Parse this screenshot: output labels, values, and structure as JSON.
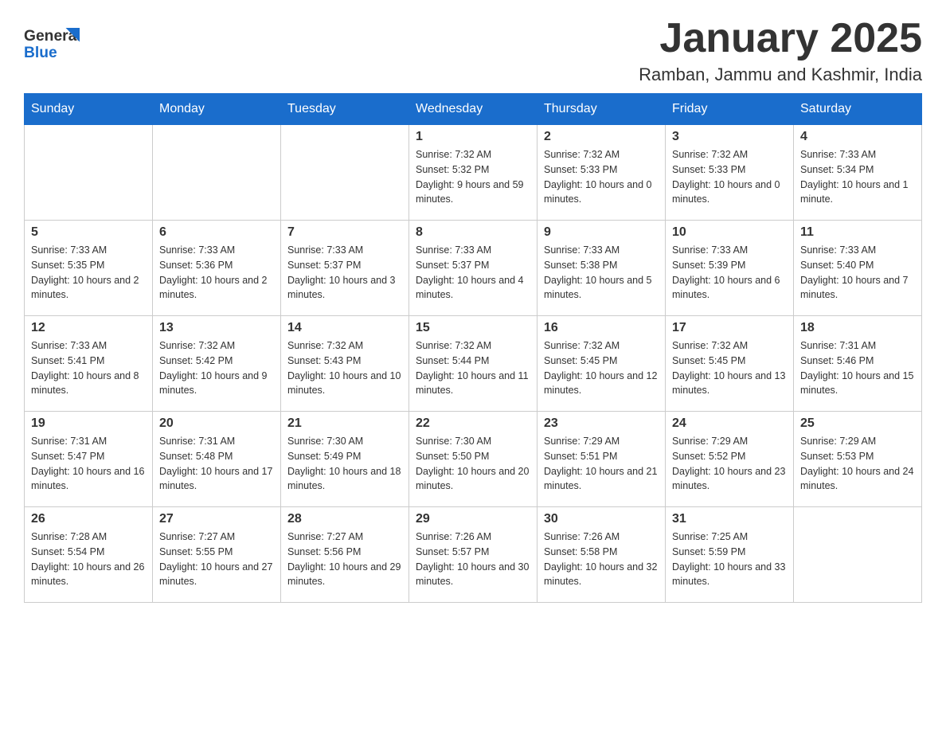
{
  "header": {
    "title": "January 2025",
    "location": "Ramban, Jammu and Kashmir, India",
    "logo_general": "General",
    "logo_blue": "Blue"
  },
  "days_of_week": [
    "Sunday",
    "Monday",
    "Tuesday",
    "Wednesday",
    "Thursday",
    "Friday",
    "Saturday"
  ],
  "weeks": [
    [
      {
        "day": "",
        "sunrise": "",
        "sunset": "",
        "daylight": ""
      },
      {
        "day": "",
        "sunrise": "",
        "sunset": "",
        "daylight": ""
      },
      {
        "day": "",
        "sunrise": "",
        "sunset": "",
        "daylight": ""
      },
      {
        "day": "1",
        "sunrise": "Sunrise: 7:32 AM",
        "sunset": "Sunset: 5:32 PM",
        "daylight": "Daylight: 9 hours and 59 minutes."
      },
      {
        "day": "2",
        "sunrise": "Sunrise: 7:32 AM",
        "sunset": "Sunset: 5:33 PM",
        "daylight": "Daylight: 10 hours and 0 minutes."
      },
      {
        "day": "3",
        "sunrise": "Sunrise: 7:32 AM",
        "sunset": "Sunset: 5:33 PM",
        "daylight": "Daylight: 10 hours and 0 minutes."
      },
      {
        "day": "4",
        "sunrise": "Sunrise: 7:33 AM",
        "sunset": "Sunset: 5:34 PM",
        "daylight": "Daylight: 10 hours and 1 minute."
      }
    ],
    [
      {
        "day": "5",
        "sunrise": "Sunrise: 7:33 AM",
        "sunset": "Sunset: 5:35 PM",
        "daylight": "Daylight: 10 hours and 2 minutes."
      },
      {
        "day": "6",
        "sunrise": "Sunrise: 7:33 AM",
        "sunset": "Sunset: 5:36 PM",
        "daylight": "Daylight: 10 hours and 2 minutes."
      },
      {
        "day": "7",
        "sunrise": "Sunrise: 7:33 AM",
        "sunset": "Sunset: 5:37 PM",
        "daylight": "Daylight: 10 hours and 3 minutes."
      },
      {
        "day": "8",
        "sunrise": "Sunrise: 7:33 AM",
        "sunset": "Sunset: 5:37 PM",
        "daylight": "Daylight: 10 hours and 4 minutes."
      },
      {
        "day": "9",
        "sunrise": "Sunrise: 7:33 AM",
        "sunset": "Sunset: 5:38 PM",
        "daylight": "Daylight: 10 hours and 5 minutes."
      },
      {
        "day": "10",
        "sunrise": "Sunrise: 7:33 AM",
        "sunset": "Sunset: 5:39 PM",
        "daylight": "Daylight: 10 hours and 6 minutes."
      },
      {
        "day": "11",
        "sunrise": "Sunrise: 7:33 AM",
        "sunset": "Sunset: 5:40 PM",
        "daylight": "Daylight: 10 hours and 7 minutes."
      }
    ],
    [
      {
        "day": "12",
        "sunrise": "Sunrise: 7:33 AM",
        "sunset": "Sunset: 5:41 PM",
        "daylight": "Daylight: 10 hours and 8 minutes."
      },
      {
        "day": "13",
        "sunrise": "Sunrise: 7:32 AM",
        "sunset": "Sunset: 5:42 PM",
        "daylight": "Daylight: 10 hours and 9 minutes."
      },
      {
        "day": "14",
        "sunrise": "Sunrise: 7:32 AM",
        "sunset": "Sunset: 5:43 PM",
        "daylight": "Daylight: 10 hours and 10 minutes."
      },
      {
        "day": "15",
        "sunrise": "Sunrise: 7:32 AM",
        "sunset": "Sunset: 5:44 PM",
        "daylight": "Daylight: 10 hours and 11 minutes."
      },
      {
        "day": "16",
        "sunrise": "Sunrise: 7:32 AM",
        "sunset": "Sunset: 5:45 PM",
        "daylight": "Daylight: 10 hours and 12 minutes."
      },
      {
        "day": "17",
        "sunrise": "Sunrise: 7:32 AM",
        "sunset": "Sunset: 5:45 PM",
        "daylight": "Daylight: 10 hours and 13 minutes."
      },
      {
        "day": "18",
        "sunrise": "Sunrise: 7:31 AM",
        "sunset": "Sunset: 5:46 PM",
        "daylight": "Daylight: 10 hours and 15 minutes."
      }
    ],
    [
      {
        "day": "19",
        "sunrise": "Sunrise: 7:31 AM",
        "sunset": "Sunset: 5:47 PM",
        "daylight": "Daylight: 10 hours and 16 minutes."
      },
      {
        "day": "20",
        "sunrise": "Sunrise: 7:31 AM",
        "sunset": "Sunset: 5:48 PM",
        "daylight": "Daylight: 10 hours and 17 minutes."
      },
      {
        "day": "21",
        "sunrise": "Sunrise: 7:30 AM",
        "sunset": "Sunset: 5:49 PM",
        "daylight": "Daylight: 10 hours and 18 minutes."
      },
      {
        "day": "22",
        "sunrise": "Sunrise: 7:30 AM",
        "sunset": "Sunset: 5:50 PM",
        "daylight": "Daylight: 10 hours and 20 minutes."
      },
      {
        "day": "23",
        "sunrise": "Sunrise: 7:29 AM",
        "sunset": "Sunset: 5:51 PM",
        "daylight": "Daylight: 10 hours and 21 minutes."
      },
      {
        "day": "24",
        "sunrise": "Sunrise: 7:29 AM",
        "sunset": "Sunset: 5:52 PM",
        "daylight": "Daylight: 10 hours and 23 minutes."
      },
      {
        "day": "25",
        "sunrise": "Sunrise: 7:29 AM",
        "sunset": "Sunset: 5:53 PM",
        "daylight": "Daylight: 10 hours and 24 minutes."
      }
    ],
    [
      {
        "day": "26",
        "sunrise": "Sunrise: 7:28 AM",
        "sunset": "Sunset: 5:54 PM",
        "daylight": "Daylight: 10 hours and 26 minutes."
      },
      {
        "day": "27",
        "sunrise": "Sunrise: 7:27 AM",
        "sunset": "Sunset: 5:55 PM",
        "daylight": "Daylight: 10 hours and 27 minutes."
      },
      {
        "day": "28",
        "sunrise": "Sunrise: 7:27 AM",
        "sunset": "Sunset: 5:56 PM",
        "daylight": "Daylight: 10 hours and 29 minutes."
      },
      {
        "day": "29",
        "sunrise": "Sunrise: 7:26 AM",
        "sunset": "Sunset: 5:57 PM",
        "daylight": "Daylight: 10 hours and 30 minutes."
      },
      {
        "day": "30",
        "sunrise": "Sunrise: 7:26 AM",
        "sunset": "Sunset: 5:58 PM",
        "daylight": "Daylight: 10 hours and 32 minutes."
      },
      {
        "day": "31",
        "sunrise": "Sunrise: 7:25 AM",
        "sunset": "Sunset: 5:59 PM",
        "daylight": "Daylight: 10 hours and 33 minutes."
      },
      {
        "day": "",
        "sunrise": "",
        "sunset": "",
        "daylight": ""
      }
    ]
  ]
}
